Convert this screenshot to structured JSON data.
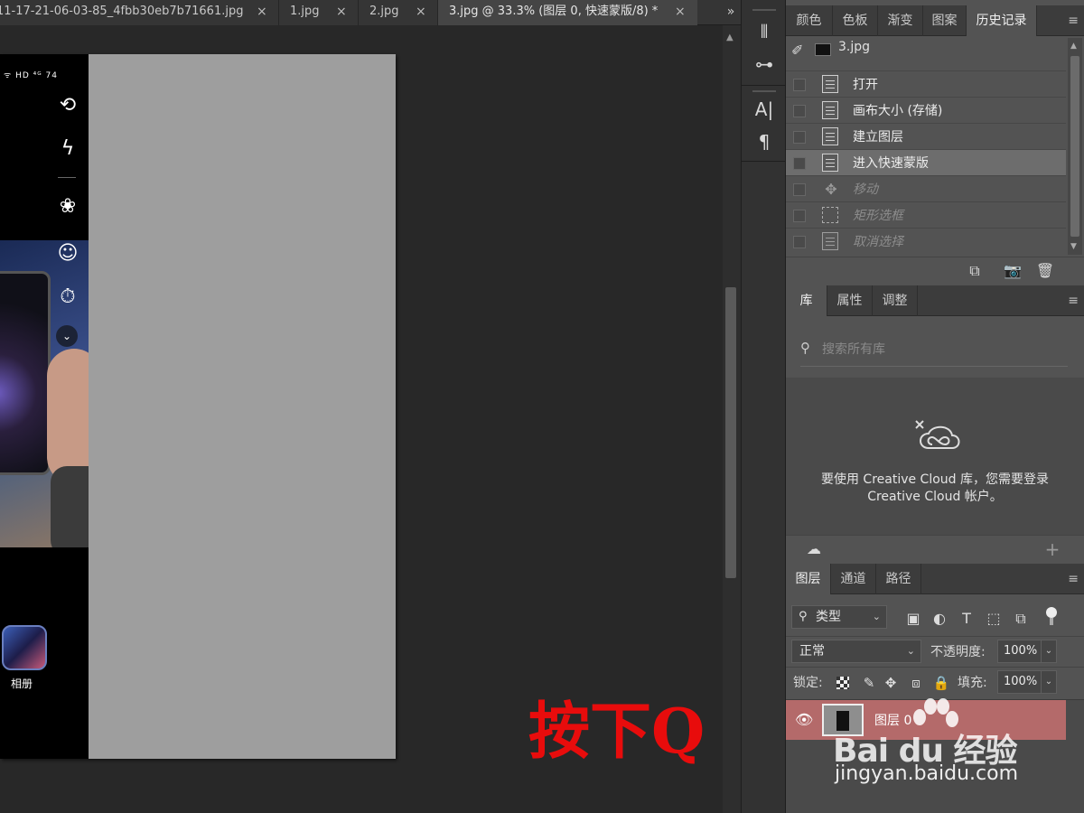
{
  "tabs": [
    {
      "label": "11-17-21-06-03-85_4fbb30eb7b71661.jpg",
      "close": "×",
      "active": false
    },
    {
      "label": "1.jpg",
      "close": "×",
      "active": false
    },
    {
      "label": "2.jpg",
      "close": "×",
      "active": false
    },
    {
      "label": "3.jpg @ 33.3% (图层 0, 快速蒙版/8) *",
      "close": "×",
      "active": true
    }
  ],
  "tab_overflow": "»",
  "canvas": {
    "status_icons": "ᯤ HD ⁴ᴳ 74",
    "album_label": "相册",
    "annotation": "按下Q"
  },
  "toolstrip": {
    "icons": [
      "brush-settings-icon",
      "tool-presets-icon",
      "character-icon",
      "paragraph-icon"
    ],
    "glyphs": [
      "⦀",
      "⊶",
      "A|",
      "¶"
    ]
  },
  "history_panel": {
    "tabs": [
      "颜色",
      "色板",
      "渐变",
      "图案",
      "历史记录"
    ],
    "active_tab": "历史记录",
    "menu": "≡",
    "snapshot_name": "3.jpg",
    "items": [
      {
        "label": "打开",
        "icon": "document-icon",
        "state": "past"
      },
      {
        "label": "画布大小 (存储)",
        "icon": "document-icon",
        "state": "past"
      },
      {
        "label": "建立图层",
        "icon": "document-icon",
        "state": "past"
      },
      {
        "label": "进入快速蒙版",
        "icon": "document-icon",
        "state": "selected"
      },
      {
        "label": "移动",
        "icon": "move-icon",
        "state": "future"
      },
      {
        "label": "矩形选框",
        "icon": "marquee-icon",
        "state": "future"
      },
      {
        "label": "取消选择",
        "icon": "document-icon",
        "state": "future"
      }
    ],
    "footer_icons": {
      "new_doc": "⧉",
      "snapshot": "📷",
      "delete": "🗑"
    }
  },
  "libraries_panel": {
    "tabs": [
      "库",
      "属性",
      "调整"
    ],
    "active_tab": "库",
    "menu": "≡",
    "search_placeholder": "搜索所有库",
    "message": "要使用 Creative Cloud 库，您需要登录 Creative Cloud 帐户。",
    "footer_add": "+"
  },
  "layers_panel": {
    "tabs": [
      "图层",
      "通道",
      "路径"
    ],
    "active_tab": "图层",
    "menu": "≡",
    "filter_kind": "类型",
    "blend_mode": "正常",
    "opacity_label": "不透明度:",
    "opacity_value": "100%",
    "lock_label": "锁定:",
    "fill_label": "填充:",
    "fill_value": "100%",
    "caret": "⌄",
    "layers": [
      {
        "name": "图层 0",
        "visible": true,
        "selected": true
      }
    ]
  },
  "watermark": {
    "logo": "Bai du 经验",
    "url": "jingyan.baidu.com"
  },
  "colors": {
    "accent_layer_row": "#b46a6a",
    "annotation": "#e80c0c",
    "canvas_gray": "#9e9e9e"
  }
}
